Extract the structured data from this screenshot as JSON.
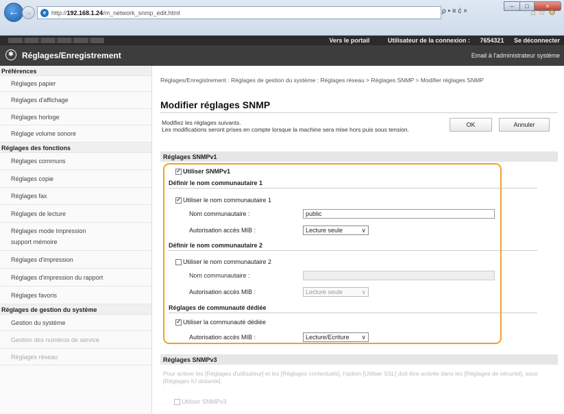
{
  "browser": {
    "url_prefix": "http://",
    "url_host": "192.168.1.24",
    "url_path": "/m_network_snmp_edit.html",
    "address_tools": "ρ • ≡ ć ×",
    "window_buttons": {
      "min": "–",
      "max": "□",
      "close": "×"
    }
  },
  "topbar": {
    "portal_link": "Vers le portail",
    "user_label": "Utilisateur de la connexion :",
    "user_id": "7654321",
    "logout": "Se déconnecter"
  },
  "header": {
    "title": "Réglages/Enregistrement",
    "mail_link": "Email à l'administrateur système"
  },
  "sidebar": {
    "sections": [
      {
        "title": "Préférences",
        "items": [
          "Réglages papier",
          "Réglages d'affichage",
          "Réglages horloge",
          "Réglage volume sonore"
        ]
      },
      {
        "title": "Réglages des fonctions",
        "items": [
          "Réglages communs",
          "Réglages copie",
          "Réglages fax",
          "Réglages de lecture",
          "Réglages mode Impression support mémoire",
          "Réglages d'impression",
          "Réglages d'impression du rapport",
          "Réglages favoris"
        ]
      },
      {
        "title": "Réglages de gestion du système",
        "items": [
          "Gestion du système",
          "Gestion des numéros de service",
          "Réglages réseau"
        ]
      }
    ]
  },
  "main": {
    "breadcrumb": "Réglages/Enregistrement : Réglages de gestion du système : Réglages réseau > Réglages SNMP > Modifier réglages SNMP",
    "title": "Modifier réglages SNMP",
    "desc_line1": "Modifiez les réglages suivants.",
    "desc_line2": "Les modifications seront prises en compte lorsque la machine sera mise hors puis sous tension.",
    "ok_label": "OK",
    "cancel_label": "Annuler",
    "v1": {
      "section_title": "Réglages SNMPv1",
      "use_v1": "Utiliser SNMPv1",
      "community1_title": "Définir le nom communautaire 1",
      "use_community1": "Utiliser le nom communautaire 1",
      "community_name_label": "Nom communautaire :",
      "community1_value": "public",
      "mib_label": "Autorisation accès MIB :",
      "mib1_value": "Lecture seule",
      "community2_title": "Définir le nom communautaire 2",
      "use_community2": "Utiliser le nom communautaire 2",
      "community2_value": "",
      "mib2_value": "Lecture seule",
      "dedicated_title": "Réglages de communauté dédiée",
      "use_dedicated": "Utiliser la communauté dédiée",
      "mib3_value": "Lecture/Ecriture"
    },
    "v3": {
      "section_title": "Réglages SNMPv3",
      "note": "Pour activer les [Réglages d'utilisateur] et les [Réglages contextuels], l'option [Utiliser SSL] doit être activée dans les [Réglages de sécurité], sous [Réglages IU distante].",
      "use_v3": "Utiliser SNMPv3"
    }
  }
}
